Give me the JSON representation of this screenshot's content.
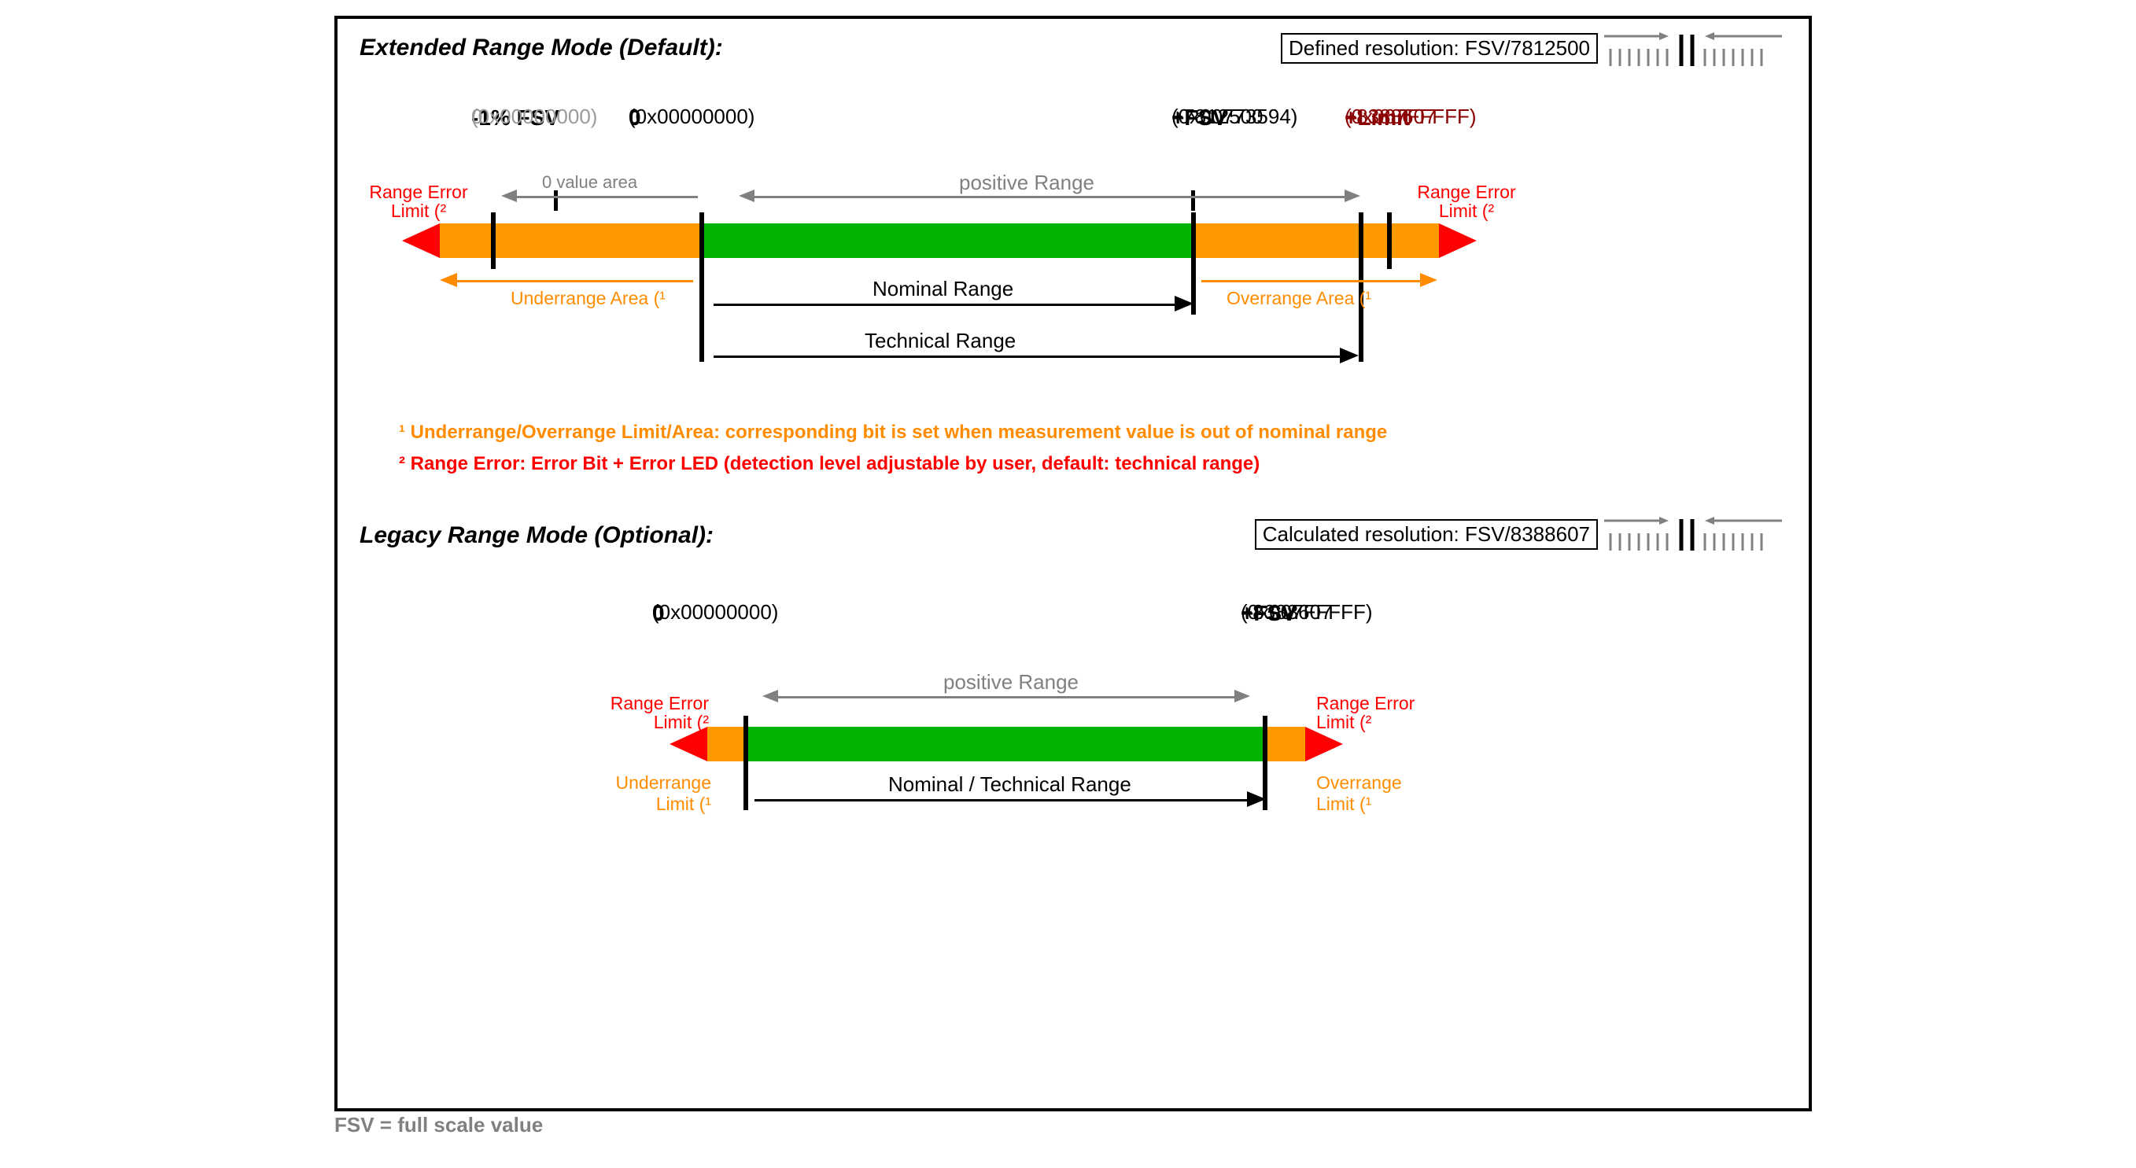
{
  "extended": {
    "title": "Extended Range Mode (Default):",
    "resolution": "Defined resolution: FSV/7812500",
    "markers": {
      "neg1": {
        "head": "-1% FSV",
        "val": "0",
        "hex": "(0x00000000)"
      },
      "zero": {
        "head": "0",
        "val": "0",
        "hex": "(0x00000000)"
      },
      "fsv": {
        "head": "+FSV",
        "val": "+7812500",
        "hex": "(0x00773594)"
      },
      "limit": {
        "head": "+Limit",
        "val": "+8388607",
        "hex": "(0x007FFFFF)"
      }
    },
    "labels": {
      "range_error_L": "Range Error\nLimit (²",
      "range_error_R": "Range Error\nLimit (²",
      "zero_value_area": "0 value area",
      "positive_range": "positive Range",
      "underrange": "Underrange Area (¹",
      "overrange": "Overrange Area (¹",
      "nominal": "Nominal Range",
      "technical": "Technical Range"
    }
  },
  "legacy": {
    "title": "Legacy Range Mode (Optional):",
    "resolution": "Calculated resolution: FSV/8388607",
    "markers": {
      "zero": {
        "head": "0",
        "val": "0",
        "hex": "(0x00000000)"
      },
      "fsv": {
        "head": "+FSV",
        "val": "+8388607",
        "hex": "(0x007FFFFF)"
      }
    },
    "labels": {
      "range_error_L": "Range Error\nLimit (²",
      "range_error_R": "Range Error\nLimit (²",
      "underrange": "Underrange\nLimit (¹",
      "overrange": "Overrange\nLimit (¹",
      "nominal_tech": "Nominal / Technical Range",
      "positive_range": "positive Range"
    }
  },
  "footnotes": {
    "f1": "¹ Underrange/Overrange Limit/Area: corresponding bit is set when measurement value is out of nominal range",
    "f2": "² Range Error: Error Bit + Error LED (detection level adjustable by user, default: technical range)"
  },
  "caption": "FSV = full scale value"
}
